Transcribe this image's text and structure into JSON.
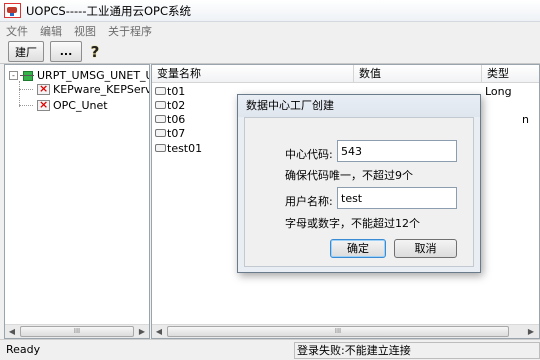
{
  "window": {
    "title": "UOPCS-----工业通用云OPC系统"
  },
  "menu": [
    "文件",
    "编辑",
    "视图",
    "关于程序"
  ],
  "toolbar": {
    "build_label": "建厂",
    "more_label": "...",
    "help_glyph": "?"
  },
  "tree": {
    "root": "URPT_UMSG_UNET_UC",
    "children": [
      "KEPware_KEPServer",
      "OPC_Unet"
    ],
    "expander": "-"
  },
  "list": {
    "columns": [
      "变量名称",
      "数值",
      "类型"
    ],
    "rows": [
      {
        "name": "t01",
        "type": "Long"
      },
      {
        "name": "t02",
        "type": ""
      },
      {
        "name": "t06",
        "type": "n"
      },
      {
        "name": "t07",
        "type": ""
      },
      {
        "name": "test01",
        "type": ""
      }
    ]
  },
  "scroll": {
    "grip": "III",
    "left_arrow": "◀",
    "right_arrow": "▶"
  },
  "status": {
    "left": "Ready",
    "message": "登录失败:不能建立连接"
  },
  "dialog": {
    "title": "数据中心工厂创建",
    "code_label": "中心代码:",
    "code_value": "543",
    "code_hint": "确保代码唯一，不超过9个",
    "user_label": "用户名称:",
    "user_value": "test",
    "user_hint": "字母或数字，不能超过12个",
    "ok_label": "确定",
    "cancel_label": "取消"
  }
}
